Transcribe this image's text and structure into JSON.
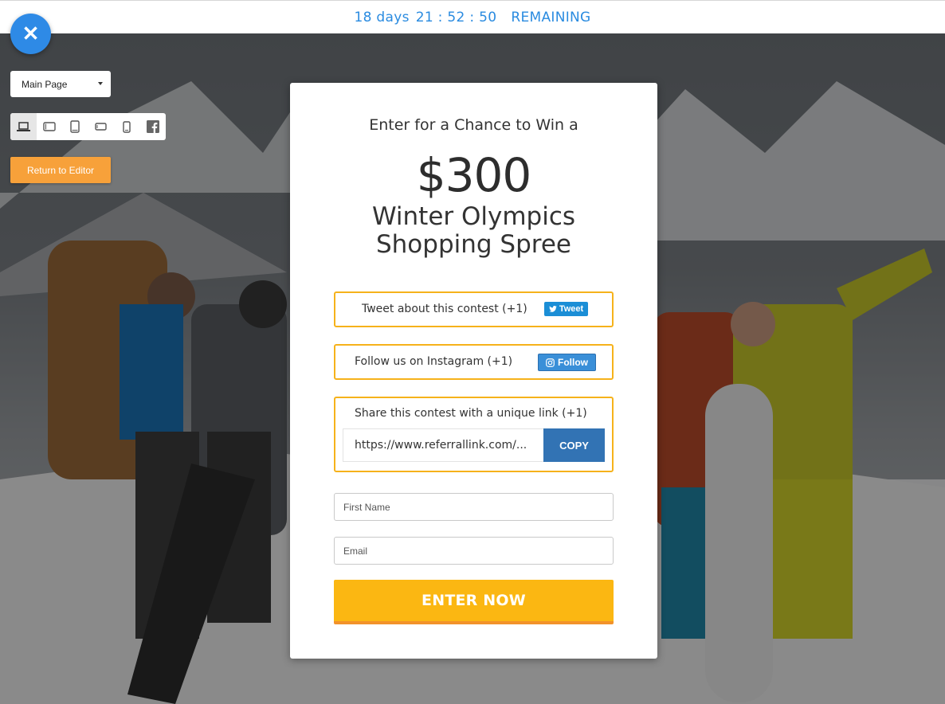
{
  "countdown": {
    "days": "18 days",
    "clock": "21 : 52 : 50",
    "label": "REMAINING"
  },
  "toolbar": {
    "close_icon": "close-icon",
    "page_select": "Main Page",
    "devices": [
      "desktop",
      "tablet-landscape",
      "tablet-portrait",
      "phone-landscape",
      "phone-portrait",
      "facebook"
    ],
    "return_label": "Return to Editor"
  },
  "card": {
    "pre_title": "Enter for a Chance to Win a",
    "amount": "$300",
    "title_line1": "Winter Olympics",
    "title_line2": "Shopping Spree"
  },
  "actions": {
    "tweet": {
      "label": "Tweet about this contest (+1)",
      "button": "Tweet"
    },
    "instagram": {
      "label": "Follow us on Instagram (+1)",
      "button": "Follow"
    },
    "share": {
      "label": "Share this contest with a unique link (+1)",
      "link": "https://www.referrallink.com/...",
      "button": "COPY"
    }
  },
  "form": {
    "first_name_placeholder": "First Name",
    "email_placeholder": "Email",
    "submit": "ENTER NOW"
  },
  "colors": {
    "accent": "#2e8ae6",
    "border": "#f6b21b",
    "submit": "#fbb712",
    "return": "#f7a13a",
    "copy": "#3273b4"
  }
}
